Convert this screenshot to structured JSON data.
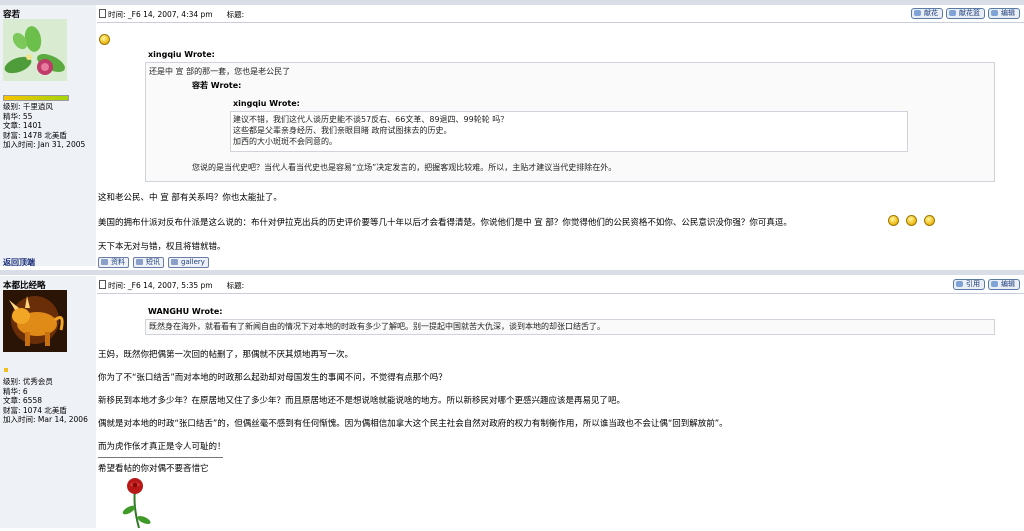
{
  "posts": [
    {
      "username": "容若",
      "info": [
        "级别: 千里逍风",
        "精华: 55",
        "文章: 1401",
        "财富: 1478 北美盾",
        "加入时间: Jan 31, 2005"
      ],
      "time_label": "时间: _F6 14, 2007, 4:34 pm",
      "subject_label": "标题:",
      "buttons": [
        "献花",
        "献花篮",
        "编辑"
      ],
      "outer_quote_author": "xingqiu Wrote:",
      "outer_quote_text": "还是中  宣  部的那一套，您也是老公民了",
      "inner_quote_author": "容若  Wrote:",
      "inner2_quote_author": "xingqiu Wrote:",
      "inner2_quote_lines": [
        "建议不错，我们这代人谈历史能不谈57反右、66文革、89退四、99轮轮  吗？",
        "这些都是父辈亲身经历、我们亲眼目睹  政府试图抹去的历史。",
        "加西的大小斑斑不会同意的。"
      ],
      "inner_quote_tail": "您说的是当代史吧？当代人看当代史也是容易“立场”决定发言的，把握客观比较难。所以，主贴才建议当代史排除在外。",
      "body": [
        "这和老公民、中  宣  部有关系吗？你也太能扯了。",
        "美国的拥布什派对反布什派是这么说的：布什对伊拉克出兵的历史评价要等几十年以后才会看得清楚。你说他们是中  宣  部？你觉得他们的公民资格不如你、公民意识没你强？你可真逗。",
        "天下本无对与错，权且将错就错。"
      ],
      "back_top": "返回顶端",
      "footer_buttons": [
        "资料",
        "短讯",
        "gallery"
      ]
    },
    {
      "username": "本都比经略",
      "info": [
        "级别: 优秀会员",
        "精华: 6",
        "文章: 6558",
        "财富: 1074 北美盾",
        "加入时间: Mar 14, 2006"
      ],
      "time_label": "时间: _F6 14, 2007, 5:35 pm",
      "subject_label": "标题:",
      "buttons": [
        "引用",
        "编辑"
      ],
      "quote_author": "WANGHU Wrote:",
      "quote_text": "既然身在海外，就看看有了新闻自由的情况下对本地的时政有多少了解吧。别一提起中国就苦大仇深，谈到本地的却张口结舌了。",
      "body": [
        "王妈，既然你把偶第一次回的帖删了，那偶就不厌其烦地再写一次。",
        "你为了不“张口结舌”而对本地的时政那么起劲却对母国发生的事闻不问，不觉得有点那个吗？",
        "新移民到本地才多少年？在原居地又住了多少年？而且原居地还不是想说啥就能说啥的地方。所以新移民对哪个更感兴趣应该是再易见了吧。",
        "偶就是对本地的时政“张口结舌”的，但偶丝毫不感到有任何惭愧。因为偶相信加拿大这个民主社会自然对政府的权力有制衡作用，所以谁当政也不会让偶“回到解放前”。",
        "而为虎作伥才真正是令人可耻的！",
        "希望看帖的你对偶不要吝惜它"
      ]
    }
  ],
  "colors": {
    "left_bg": "#eef1f6",
    "link": "#1a2f7a",
    "button_border": "#5a7aa6"
  }
}
